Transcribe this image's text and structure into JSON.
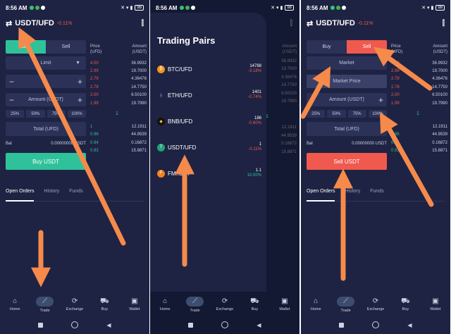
{
  "status": {
    "time": "8:56 AM",
    "battery": "98"
  },
  "pair": {
    "name": "USDT/UFD",
    "change": "-0.11%"
  },
  "trade_form": {
    "buy": "Buy",
    "sell": "Sell",
    "limit": "Limit",
    "market": "Market",
    "market_price": "Market Price",
    "amount_placeholder": "Amount (USDT)",
    "percentages": [
      "25%",
      "50%",
      "75%",
      "100%"
    ],
    "total_placeholder": "Total (UFD)",
    "bal_label": "Bal",
    "bal_value": "0.00000000 USDT",
    "buy_button": "Buy USDT",
    "sell_button": "Sell USDT"
  },
  "order_book": {
    "price_header": "Price\n(UFD)",
    "amount_header": "Amount\n(USDT)",
    "asks": [
      {
        "price": "4.00",
        "amount": "36.9932"
      },
      {
        "price": "2.99",
        "amount": "19.7000"
      },
      {
        "price": "2.79",
        "amount": "4.36476"
      },
      {
        "price": "2.78",
        "amount": "14.7750"
      },
      {
        "price": "2.00",
        "amount": "6.50100"
      },
      {
        "price": "1.99",
        "amount": "19.7990"
      }
    ],
    "mid": "1",
    "bids": [
      {
        "price": "1",
        "amount": "12.1911"
      },
      {
        "price": "0.96",
        "amount": "44.9539"
      },
      {
        "price": "0.94",
        "amount": "0.16872"
      },
      {
        "price": "0.93",
        "amount": "15.8871"
      }
    ]
  },
  "order_tabs": [
    "Open Orders",
    "History",
    "Funds"
  ],
  "nav": [
    {
      "label": "Home",
      "icon": "home-icon"
    },
    {
      "label": "Trade",
      "icon": "trade-icon"
    },
    {
      "label": "Exchange",
      "icon": "exchange-icon"
    },
    {
      "label": "Buy",
      "icon": "cart-icon"
    },
    {
      "label": "Wallet",
      "icon": "wallet-icon"
    }
  ],
  "drawer": {
    "title": "Trading Pairs",
    "pairs": [
      {
        "name": "BTC/UFD",
        "price": "14788",
        "change": "-3.18%",
        "color": "#f7931a"
      },
      {
        "name": "ETH/UFD",
        "price": "1401",
        "change": "-0.74%",
        "color": "#627eea"
      },
      {
        "name": "BNB/UFD",
        "price": "186",
        "change": "-0.60%",
        "color": "#f3ba2f"
      },
      {
        "name": "USDT/UFD",
        "price": "1",
        "change": "-0.11%",
        "color": "#26a17b"
      },
      {
        "name": "FM..SDT",
        "price": "1.1",
        "change": "10.00%",
        "color": "#f58220"
      }
    ]
  },
  "colors": {
    "buy": "#2fc29a",
    "sell": "#f0594d",
    "arrow": "#f58a4b",
    "panel": "#1e2343"
  }
}
